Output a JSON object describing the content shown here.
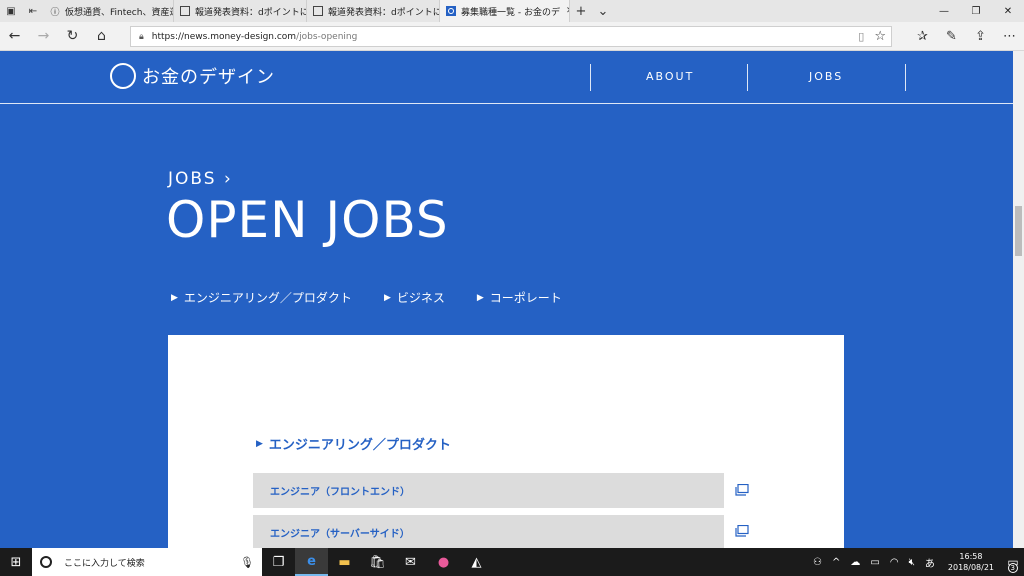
{
  "browser": {
    "tabs": [
      {
        "title": "仮想通貨、Fintech、資産運用",
        "active": false,
        "icon": "info-icon"
      },
      {
        "title": "報道発表資料：dポイントによ",
        "active": false,
        "icon": "page-icon"
      },
      {
        "title": "報道発表資料：dポイントによ",
        "active": false,
        "icon": "page-icon"
      },
      {
        "title": "募集職種一覧 - お金のデ",
        "active": true,
        "icon": "site-favicon",
        "close": "✕"
      }
    ],
    "new_tab": "+",
    "tab_menu": "⌄",
    "url_domain": "https://news.money-design.com",
    "url_path": "/jobs-opening"
  },
  "site": {
    "logo_text": "お金のデザイン",
    "nav": [
      "ABOUT",
      "JOBS"
    ],
    "breadcrumb": "JOBS",
    "breadcrumb_arrow": "›",
    "title": "OPEN JOBS",
    "categories": [
      "エンジニアリング／プロダクト",
      "ビジネス",
      "コーポレート"
    ],
    "section_heading": "エンジニアリング／プロダクト",
    "jobs": [
      "エンジニア（フロントエンド）",
      "エンジニア（サーバーサイド）"
    ]
  },
  "taskbar": {
    "search_placeholder": "ここに入力して検索",
    "ime": "あ",
    "time": "16:58",
    "date": "2018/08/21",
    "notification_count": "3"
  },
  "colors": {
    "brand_blue": "#2561c4",
    "row_gray": "#dcdcdc"
  }
}
